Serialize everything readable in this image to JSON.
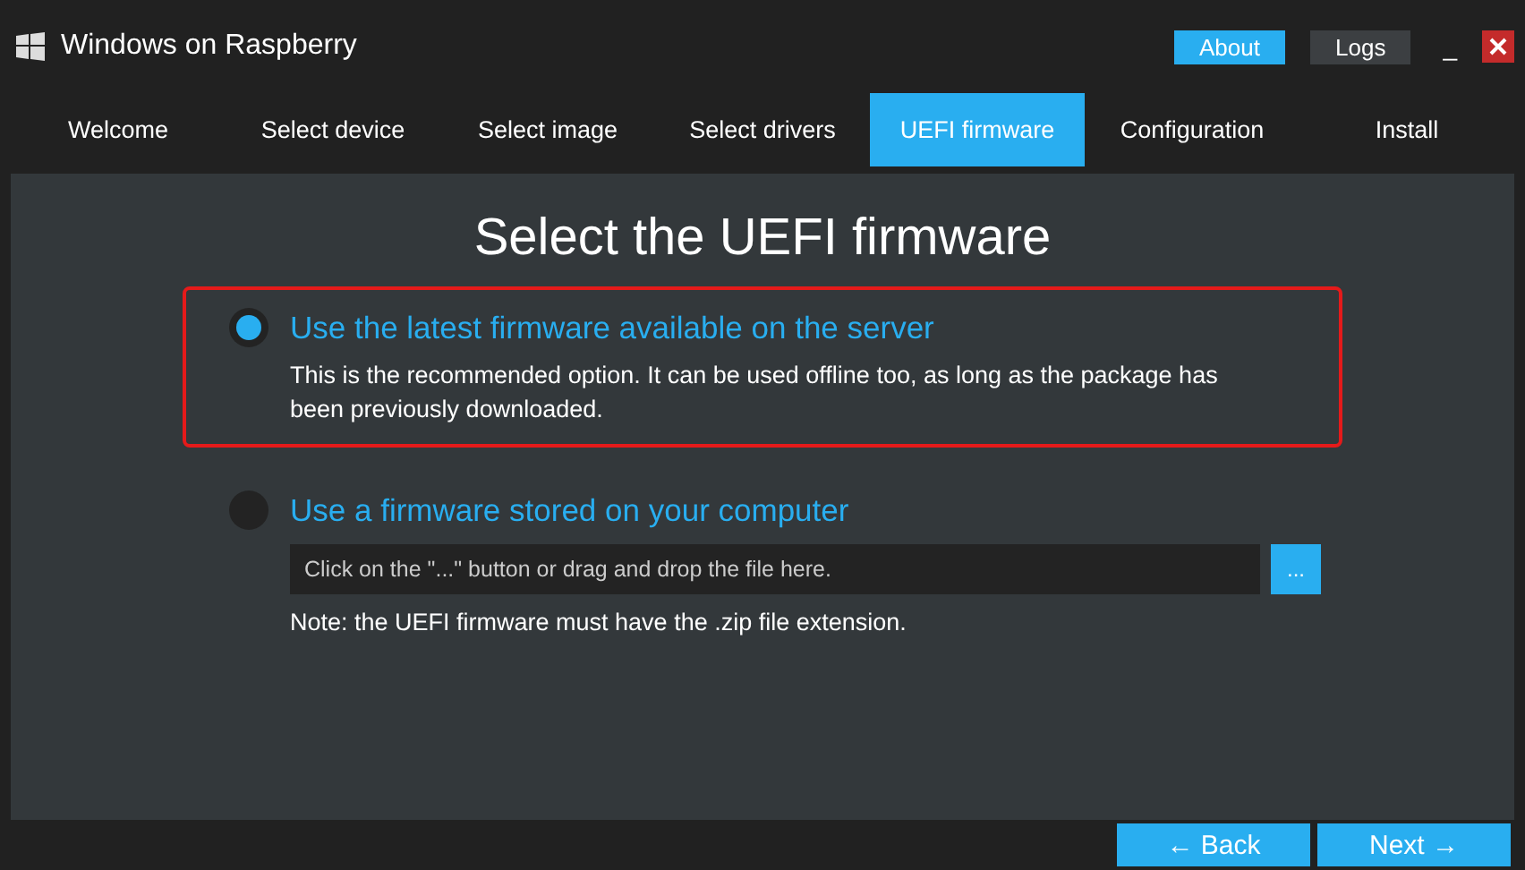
{
  "window": {
    "title": "Windows on Raspberry",
    "buttons": [
      {
        "label": "About",
        "selected": true
      },
      {
        "label": "Logs",
        "selected": false
      }
    ],
    "minimize": "_"
  },
  "tabs": [
    {
      "label": "Welcome",
      "selected": false
    },
    {
      "label": "Select device",
      "selected": false
    },
    {
      "label": "Select image",
      "selected": false
    },
    {
      "label": "Select drivers",
      "selected": false
    },
    {
      "label": "UEFI firmware",
      "selected": true
    },
    {
      "label": "Configuration",
      "selected": false
    },
    {
      "label": "Install",
      "selected": false
    }
  ],
  "heading": "Select the UEFI firmware",
  "options": [
    {
      "label": "Use the latest firmware available on the server",
      "selected": true,
      "description": "This is the recommended option. It can be used offline too, as long as the package has been previously downloaded."
    },
    {
      "label": "Use a firmware stored on your computer",
      "selected": false,
      "file_field": {
        "placeholder": "Click on the \"...\" button or drag and drop the file here.",
        "browse": "..."
      },
      "note": "Note: the UEFI firmware must have the .zip file extension."
    }
  ],
  "footer": {
    "back": "← Back",
    "next": "Next →"
  }
}
